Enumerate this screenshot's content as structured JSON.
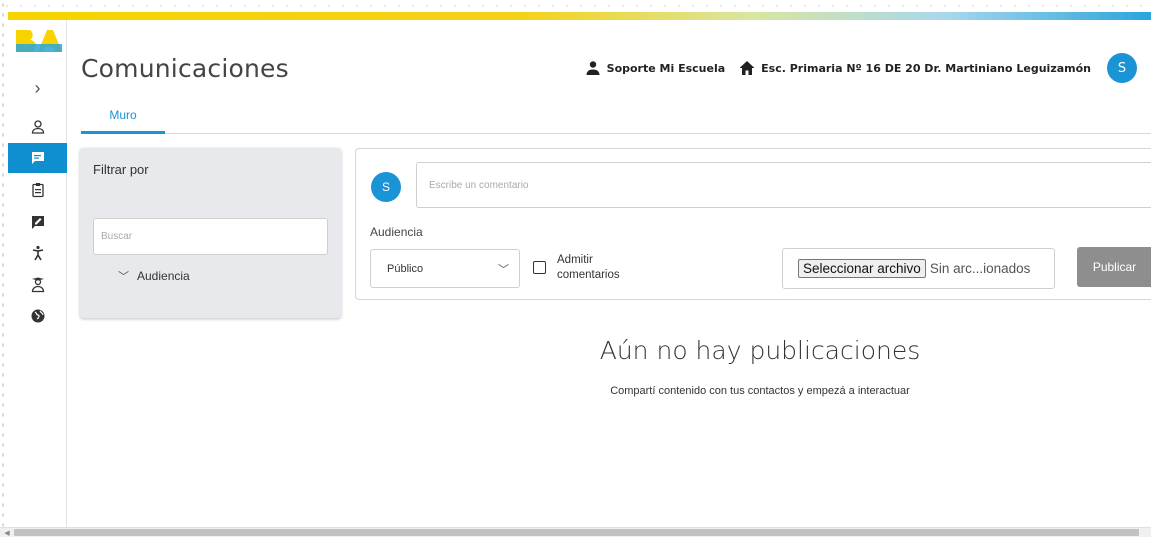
{
  "app": {
    "title": "Comunicaciones",
    "brand_colors": {
      "accent": "#1b94d6",
      "active_nav": "#0f8fcf",
      "logo_yellow": "#f8d300",
      "logo_blue": "#2aa4dc"
    },
    "logo": "BA"
  },
  "header": {
    "user_icon": "user-icon",
    "user_name": "Soporte Mi Escuela",
    "school_icon": "home-icon",
    "school_name": "Esc. Primaria Nº 16 DE 20 Dr. Martiniano Leguizamón",
    "avatar_initial": "S"
  },
  "sidebar": {
    "expand_icon": "chevron-right-icon",
    "items": [
      {
        "icon": "person-outline-icon",
        "active": false
      },
      {
        "icon": "chat-icon",
        "active": true
      },
      {
        "icon": "clipboard-icon",
        "active": false
      },
      {
        "icon": "feedback-icon",
        "active": false
      },
      {
        "icon": "activity-person-icon",
        "active": false
      },
      {
        "icon": "student-icon",
        "active": false
      },
      {
        "icon": "globe-icon",
        "active": false
      }
    ]
  },
  "tabs": [
    {
      "label": "Muro",
      "active": true
    }
  ],
  "filter": {
    "title": "Filtrar por",
    "search_placeholder": "Buscar",
    "audience_toggle": "Audiencia"
  },
  "composer": {
    "avatar_initial": "S",
    "comment_placeholder": "Escribe un comentario",
    "audience_label": "Audiencia",
    "audience_selected": "Público",
    "allow_comments_label": "Admitir comentarios",
    "allow_comments_checked": false,
    "file_button": "Seleccionar archivo",
    "file_status": "Sin arc...ionados",
    "publish_label": "Publicar"
  },
  "empty_state": {
    "title": "Aún no hay publicaciones",
    "subtitle": "Compartí contenido con tus contactos y empezá a interactuar"
  }
}
